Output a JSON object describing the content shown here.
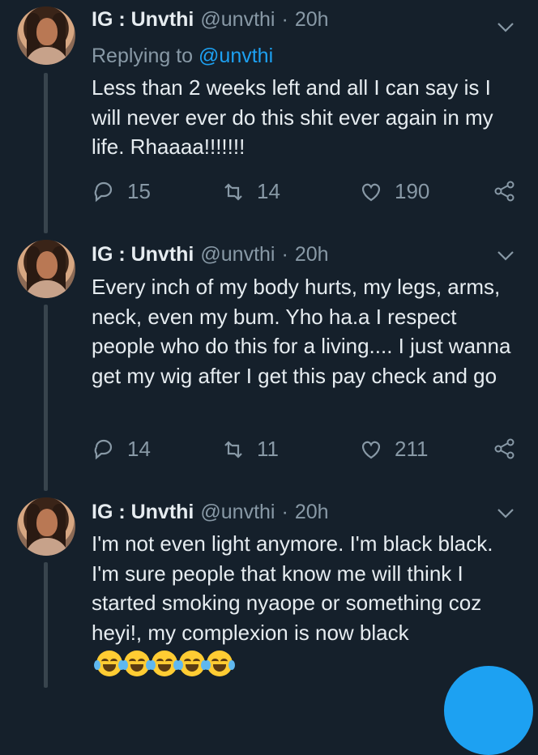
{
  "colors": {
    "background": "#15202b",
    "text_primary": "#e6ecf0",
    "text_secondary": "#8899a6",
    "accent": "#1da1f2"
  },
  "tweets": [
    {
      "display_name": "IG : Unvthi",
      "handle": "@unvthi",
      "separator": "·",
      "time": "20h",
      "replying_prefix": "Replying to",
      "replying_to": "@unvthi",
      "text": "Less than 2 weeks left and all I can say is I will never ever do this shit ever again in my life. Rhaaaa!!!!!!!",
      "replies": "15",
      "retweets": "14",
      "likes": "190"
    },
    {
      "display_name": "IG : Unvthi",
      "handle": "@unvthi",
      "separator": "·",
      "time": "20h",
      "text": "Every inch of my body hurts, my legs, arms, neck, even my bum. Yho ha.a I respect people who do this for a living.... I just wanna get my wig after I get this pay check and go",
      "replies": "14",
      "retweets": "11",
      "likes": "211"
    },
    {
      "display_name": "IG : Unvthi",
      "handle": "@unvthi",
      "separator": "·",
      "time": "20h",
      "text": "I'm not even light anymore. I'm black black. I'm sure people that know me will think I started smoking nyaope or something coz heyi!, my complexion is now black",
      "emoji_icons": [
        "face-with-tears-of-joy-icon",
        "face-with-tears-of-joy-icon",
        "face-with-tears-of-joy-icon",
        "face-with-tears-of-joy-icon",
        "face-with-tears-of-joy-icon"
      ]
    }
  ]
}
